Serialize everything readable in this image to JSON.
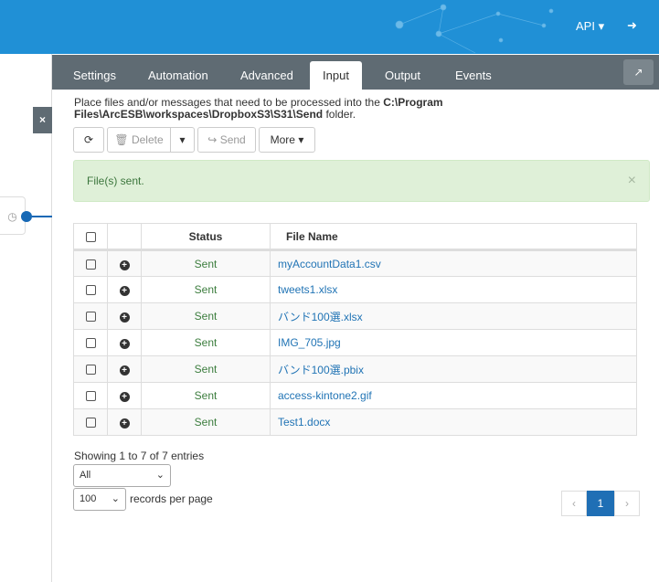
{
  "header": {
    "api_label": "API ▾",
    "logout_icon": "sign-out-icon"
  },
  "tabs": [
    {
      "label": "Settings"
    },
    {
      "label": "Automation"
    },
    {
      "label": "Advanced"
    },
    {
      "label": "Input"
    },
    {
      "label": "Output"
    },
    {
      "label": "Events"
    }
  ],
  "description": {
    "prefix": "Place files and/or messages that need to be processed into the ",
    "path": "C:\\Program Files\\ArcESB\\workspaces\\DropboxS3\\S31\\Send",
    "suffix": " folder."
  },
  "toolbar": {
    "delete": "Delete",
    "send": "Send",
    "more": "More ▾"
  },
  "alert": {
    "text": "File(s) sent.",
    "close": "×"
  },
  "table": {
    "headers": [
      "Status",
      "File Name"
    ],
    "rows": [
      {
        "status": "Sent",
        "file": "myAccountData1.csv"
      },
      {
        "status": "Sent",
        "file": "tweets1.xlsx"
      },
      {
        "status": "Sent",
        "file": "バンド100選.xlsx"
      },
      {
        "status": "Sent",
        "file": "IMG_705.jpg"
      },
      {
        "status": "Sent",
        "file": "バンド100選.pbix"
      },
      {
        "status": "Sent",
        "file": "access-kintone2.gif"
      },
      {
        "status": "Sent",
        "file": "Test1.docx"
      }
    ]
  },
  "footer": {
    "info": "Showing 1 to 7 of 7 entries",
    "filter": "All",
    "page_size": "100",
    "page_size_label": "records per page",
    "prev": "‹",
    "page": "1",
    "next": "›"
  }
}
